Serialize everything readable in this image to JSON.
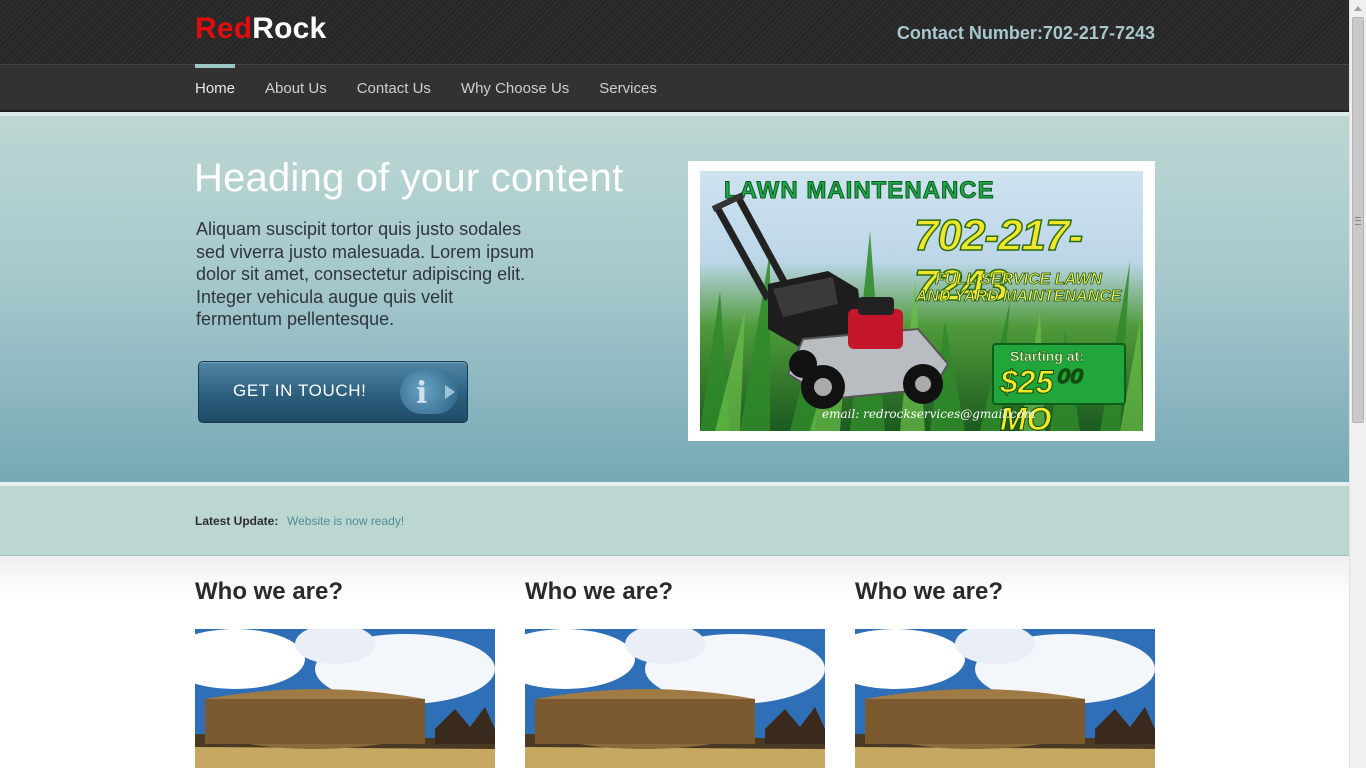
{
  "brand": {
    "logo_red": "Red",
    "logo_white": "Rock"
  },
  "header": {
    "contact_text": "Contact Number:702-217-7243"
  },
  "nav": {
    "items": [
      {
        "label": "Home",
        "active": true
      },
      {
        "label": "About Us",
        "active": false
      },
      {
        "label": "Contact Us",
        "active": false
      },
      {
        "label": "Why Choose Us",
        "active": false
      },
      {
        "label": "Services",
        "active": false
      }
    ]
  },
  "hero": {
    "heading": "Heading of your content",
    "body": "Aliquam suscipit tortor quis justo sodales sed viverra justo malesuada. Lorem ipsum dolor sit amet, consectetur adipiscing elit. Integer vehicula augue quis velit fermentum pellentesque.",
    "cta_label": "GET IN TOUCH!",
    "cta_icon_glyph": "i"
  },
  "ad": {
    "title": "LAWN MAINTENANCE",
    "phone": "702-217-7243",
    "subtitle_line1": "FULL SERVICE LAWN",
    "subtitle_line2": "AND YARD MAINTENANCE",
    "price_label": "Starting at:",
    "price_value": "$25⁰⁰ MO",
    "email": "email: redrockservices@gmail.com"
  },
  "update": {
    "label": "Latest Update:",
    "value": "Website is now ready!"
  },
  "columns": [
    {
      "heading": "Who we are?"
    },
    {
      "heading": "Who we are?"
    },
    {
      "heading": "Who we are?"
    }
  ],
  "colors": {
    "brand_red": "#e00d0d",
    "contact_text": "#a7c7cf",
    "nav_active_indicator": "#9cc7c9",
    "update_link": "#4f8c98"
  }
}
